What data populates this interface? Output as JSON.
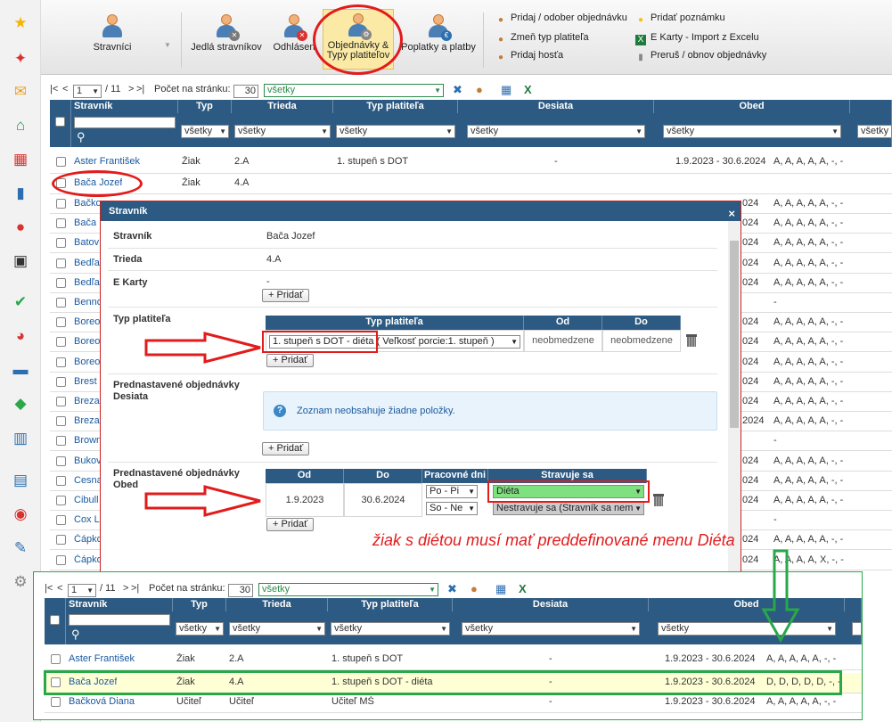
{
  "sidebar": {
    "icons": [
      "star-icon",
      "magic-wand-icon",
      "mail-icon",
      "home-icon",
      "calendar-grid-icon",
      "book-icon",
      "user-icon",
      "calendar-icon",
      "check-circle-icon",
      "chart-pie-icon",
      "briefcase-icon",
      "shield-icon",
      "bar-chart-icon",
      "open-book-icon",
      "chat-icon",
      "pen-icon",
      "gear-icon"
    ]
  },
  "toolbar": {
    "buttons": [
      {
        "label": "Stravníci"
      },
      {
        "label": "Jedlá stravníkov"
      },
      {
        "label": "Odhlásen"
      },
      {
        "label": "Objednávky &\nTypy platiteľov"
      },
      {
        "label": "Poplatky a platby"
      }
    ],
    "links": [
      {
        "label": "Pridaj / odober objednávku",
        "icon": "user-plus-icon"
      },
      {
        "label": "Zmeň typ platiteľa",
        "icon": "user-edit-icon"
      },
      {
        "label": "Pridaj hosťa",
        "icon": "user-add-icon"
      },
      {
        "label": "Pridať poznámku",
        "icon": "lightbulb-icon"
      },
      {
        "label": "E Karty - Import z Excelu",
        "icon": "excel-icon"
      },
      {
        "label": "Preruš / obnov objednávky",
        "icon": "pause-icon"
      }
    ]
  },
  "pager": {
    "first": "|<",
    "prev": "<",
    "page": "1",
    "total": "/ 11",
    "next": ">",
    "last": ">|",
    "page_size_label": "Počet na stránku:",
    "page_size": "30",
    "filter": "všetky"
  },
  "grid": {
    "columns": [
      "Stravník",
      "Typ",
      "Trieda",
      "Typ platiteľa",
      "Desiata",
      "Obed"
    ],
    "filter_value": "všetky",
    "rows": [
      {
        "name": "Aster František",
        "typ": "Žiak",
        "trieda": "2.A",
        "platitel": "1. stupeň s DOT",
        "desiata": "-",
        "obdobie": "1.9.2023 - 30.6.2024",
        "obed": "A, A, A, A, A, -, -"
      },
      {
        "name": "Bača Jozef",
        "typ": "Žiak",
        "trieda": "4.A",
        "platitel": "",
        "desiata": "",
        "obdobie": "",
        "obed": ""
      }
    ],
    "bg_names": [
      "Bačko",
      "Bača",
      "Batov",
      "Bedľa",
      "Bedľa",
      "Benno",
      "Boreo",
      "Boreo",
      "Boreo",
      "Brest",
      "Breza",
      "Breza",
      "Brown",
      "Bukov",
      "Cesna",
      "Cibull",
      "Cox L",
      "Čápko",
      "Čápko"
    ],
    "bg_obed": [
      "A, A, A, A, A, -, -",
      "A, A, A, A, A, -, -",
      "A, A, A, A, A, -, -",
      "A, A, A, A, A, -, -",
      "A, A, A, A, A, -, -",
      "-",
      "A, A, A, A, A, -, -",
      "A, A, A, A, A, -, -",
      "A, A, A, A, A, -, -",
      "A, A, A, A, A, -, -",
      "A, A, A, A, A, -, -",
      "A, A, A, A, A, -, -",
      "-",
      "A, A, A, A, A, -, -",
      "A, A, A, A, A, -, -",
      "A, A, A, A, A, -, -",
      "-",
      "A, A, A, A, A, -, -",
      "A, A, A, A, X, -, -"
    ],
    "bg_year": [
      "024",
      "024",
      "024",
      "024",
      "024",
      "",
      "024",
      "024",
      "024",
      "024",
      "024",
      "2024",
      "",
      "024",
      "024",
      "024",
      "",
      "024",
      "024"
    ]
  },
  "dialog": {
    "title": "Stravník",
    "close": "×",
    "fields": {
      "stravnik_label": "Stravník",
      "stravnik_value": "Bača Jozef",
      "trieda_label": "Trieda",
      "trieda_value": "4.A",
      "ekarty_label": "E Karty",
      "ekarty_value": "-",
      "typ_label": "Typ platiteľa",
      "desiata_label": "Prednastavené objednávky Desiata",
      "obed_label": "Prednastavené objednávky Obed"
    },
    "add_label": "+ Pridať",
    "payer_table": {
      "headers": [
        "Typ platiteľa",
        "Od",
        "Do"
      ],
      "value": "1. stupeň s DOT - diéta ( Veľkosť porcie:1. stupeň )",
      "od": "neobmedzene",
      "do": "neobmedzene"
    },
    "info": "Zoznam neobsahuje žiadne položky.",
    "obed_table": {
      "headers": [
        "Od",
        "Do",
        "Pracovné dni",
        "Stravuje sa"
      ],
      "od": "1.9.2023",
      "do": "30.6.2024",
      "days1": "Po - Pi",
      "days2": "So - Ne",
      "diet": "Diéta",
      "none": "Nestravuje sa (Stravník sa nem"
    }
  },
  "annotation": "žiak s diétou musí mať preddefinované menu Diéta",
  "zoom": {
    "pager_page": "1",
    "pager_total": "/ 11",
    "page_size": "30",
    "filter": "všetky",
    "rows": [
      {
        "name": "Aster František",
        "typ": "Žiak",
        "trieda": "2.A",
        "platitel": "1. stupeň s DOT",
        "desiata": "-",
        "obdobie": "1.9.2023 - 30.6.2024",
        "obed": "A, A, A, A, A, -, -"
      },
      {
        "name": "Bača Jozef",
        "typ": "Žiak",
        "trieda": "4.A",
        "platitel": "1. stupeň s DOT - diéta",
        "desiata": "-",
        "obdobie": "1.9.2023 - 30.6.2024",
        "obed": "D, D, D, D, D, -, -"
      },
      {
        "name": "Bačková Diana",
        "typ": "Učiteľ",
        "trieda": "Učiteľ",
        "platitel": "Učiteľ MŠ",
        "desiata": "-",
        "obdobie": "1.9.2023 - 30.6.2024",
        "obed": "A, A, A, A, A, -, -"
      }
    ]
  },
  "colors": {
    "header": "#2c5a82",
    "annotation_red": "#e21b1b",
    "annotation_green": "#29a84a",
    "diet_green": "#7fe07f"
  }
}
